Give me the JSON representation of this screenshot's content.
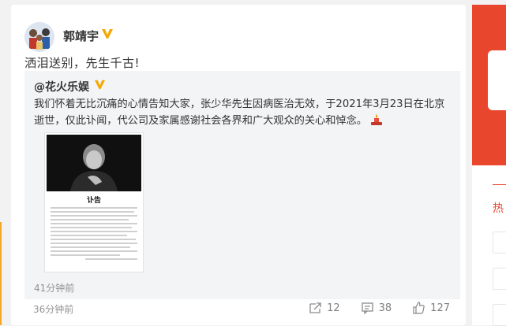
{
  "post": {
    "author": "郭靖宇",
    "text": "洒泪送别，先生千古!",
    "time": "36分钟前",
    "actions": {
      "repost_count": "12",
      "comment_count": "38",
      "like_count": "127"
    }
  },
  "repost": {
    "author": "@花火乐娱",
    "text": "我们怀着无比沉痛的心情告知大家，张少华先生因病医治无效，于2021年3月23日在北京逝世，仅此讣闻，代公司及家属感谢社会各界和广大观众的关心和悼念。",
    "time": "41分钟前",
    "image": {
      "title": "讣告"
    }
  },
  "sidebar": {
    "hot_label": "热"
  },
  "colors": {
    "verified_badge": "#f5a800",
    "sidebar_accent": "#e8462d",
    "meta_text": "#939393"
  },
  "icons": [
    "verified-icon",
    "candle-icon",
    "repost-icon",
    "comment-icon",
    "like-icon"
  ]
}
